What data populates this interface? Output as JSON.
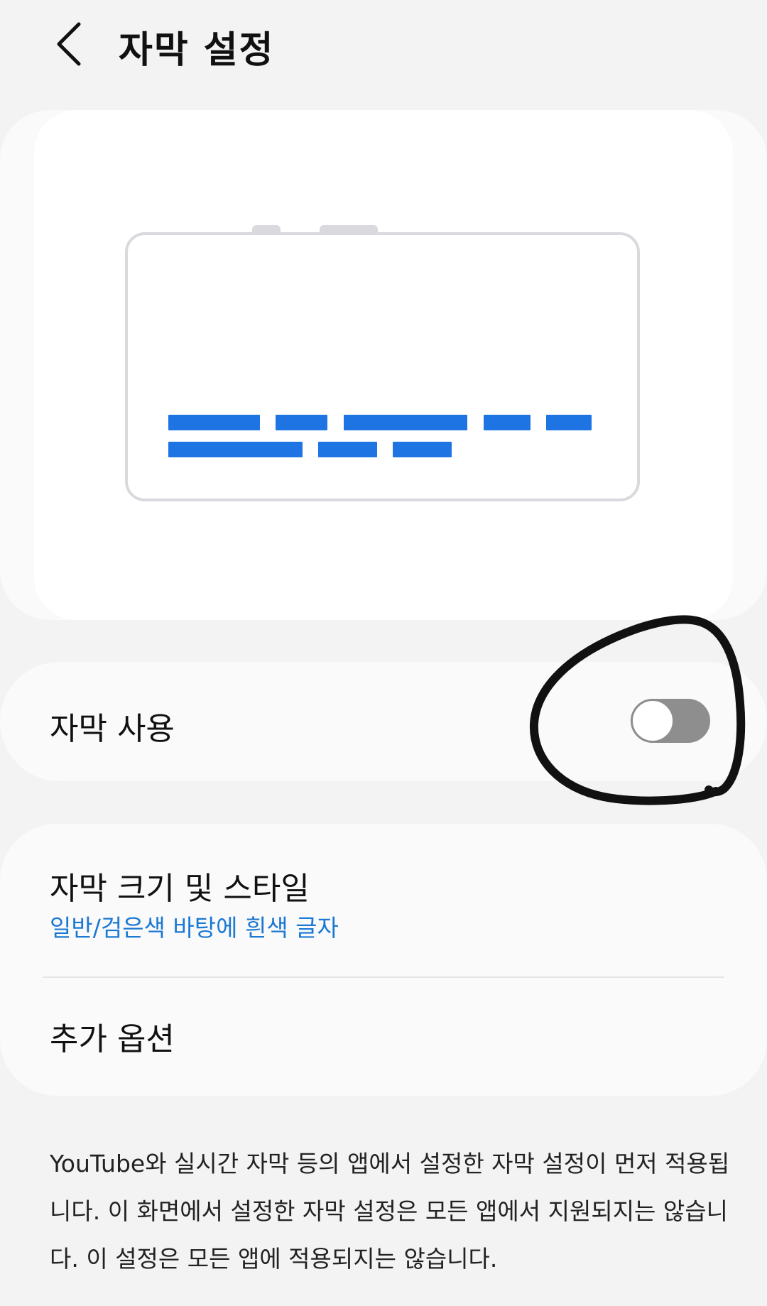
{
  "header": {
    "title": "자막 설정",
    "back_icon": "chevron-left-icon"
  },
  "preview": {
    "caption_color": "#1f74e3"
  },
  "caption_toggle": {
    "label": "자막 사용",
    "enabled": false
  },
  "settings": {
    "style": {
      "title": "자막 크기 및 스타일",
      "subtitle": "일반/검은색 바탕에 흰색 글자"
    },
    "more_options": {
      "title": "추가 옵션"
    }
  },
  "description": "YouTube와 실시간 자막 등의 앱에서 설정한 자막 설정이 먼저 적용됩니다. 이 화면에서 설정한 자막 설정은 모든 앱에서 지원되지는 않습니다. 이 설정은 모든 앱에 적용되지는 않습니다.",
  "colors": {
    "accent_blue": "#1b78d3",
    "switch_off": "#8e8e8e",
    "background": "#f3f3f3"
  }
}
